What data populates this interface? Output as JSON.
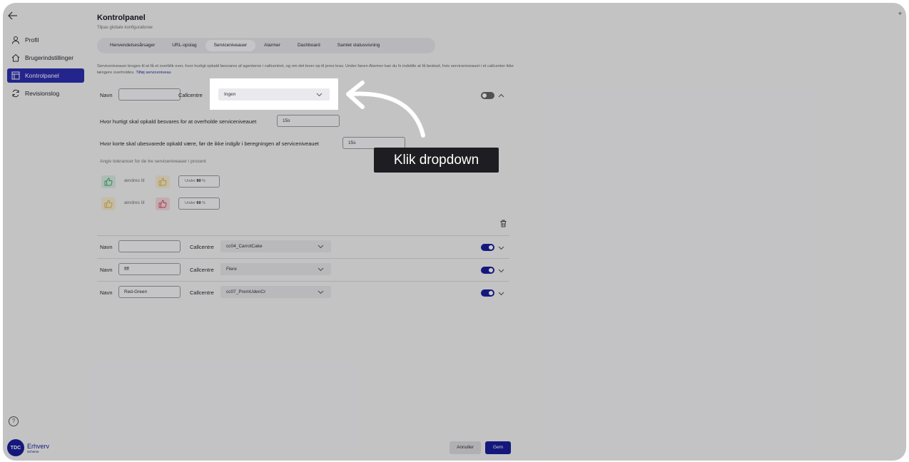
{
  "header": {
    "title": "Kontrolpanel",
    "subtitle": "Tilpas globale konfigurationer."
  },
  "sidebar": {
    "items": [
      {
        "label": "Profil",
        "icon": "person-icon"
      },
      {
        "label": "Brugerindstillinger",
        "icon": "home-icon"
      },
      {
        "label": "Kontrolpanel",
        "icon": "panel-icon",
        "active": true
      },
      {
        "label": "Revisionslog",
        "icon": "refresh-icon"
      }
    ],
    "help": "?"
  },
  "logo": {
    "badge": "TDC",
    "name": "Erhverv",
    "tagline": "Scheme"
  },
  "tabs": [
    {
      "label": "Henvendelsesårsager"
    },
    {
      "label": "URL-opslag"
    },
    {
      "label": "Serviceniveauer",
      "active": true
    },
    {
      "label": "Alarmer"
    },
    {
      "label": "Dashboard"
    },
    {
      "label": "Samlet statusvisning"
    }
  ],
  "description": {
    "text": "Serviceniveauer bruges til at få et overblik over, hvor hurtigt opkald besvares af agenterne i callcentret, og om det lever op til jeres krav. Under fanen Alarmer kan du fx indstille at få besked, hvis serviceniveauet i et callcenter ikke længere overholdes.",
    "link": "Tilføj serviceniveau"
  },
  "expanded_level": {
    "name_label": "Navn",
    "name_value": "",
    "callcentre_label": "Callcentre",
    "callcentre_value": "Ingen",
    "answer_time_label": "Hvor hurtigt skal opkald besvares for at overholde serviceniveauet",
    "answer_time_value": "15s",
    "short_calls_label": "Hvor korte skal ubesvarede opkald være, før de ikke indgår i beregningen af serviceniveauet",
    "short_calls_value": "15s",
    "tolerances_label": "Angiv tolerancer for de tre serviceniveauer i procent",
    "tolerances": [
      {
        "changes_to": "ændres til",
        "under": "Under",
        "value": "80",
        "unit": "%"
      },
      {
        "changes_to": "ændres til",
        "under": "Under",
        "value": "60",
        "unit": "%"
      }
    ]
  },
  "levels": [
    {
      "name_label": "Navn",
      "name_value": "",
      "callcentre_label": "Callcentre",
      "callcentre_value": "cc04_CarrotCake"
    },
    {
      "name_label": "Navn",
      "name_value": "ffff",
      "callcentre_label": "Callcentre",
      "callcentre_value": "Flere"
    },
    {
      "name_label": "Navn",
      "name_value": "Red-Green",
      "callcentre_label": "Callcentre",
      "callcentre_value": "cc07_PremUdenCr"
    }
  ],
  "footer": {
    "cancel": "Annuller",
    "save": "Gem"
  },
  "annotation": {
    "callout": "Klik dropdown",
    "highlight_value": "Ingen"
  },
  "colors": {
    "accent": "#1a1f9c",
    "active_nav": "#2c2fb0",
    "thumb_green": "#3aa86b",
    "thumb_yellow": "#e0b43a",
    "thumb_red": "#d2455a"
  }
}
